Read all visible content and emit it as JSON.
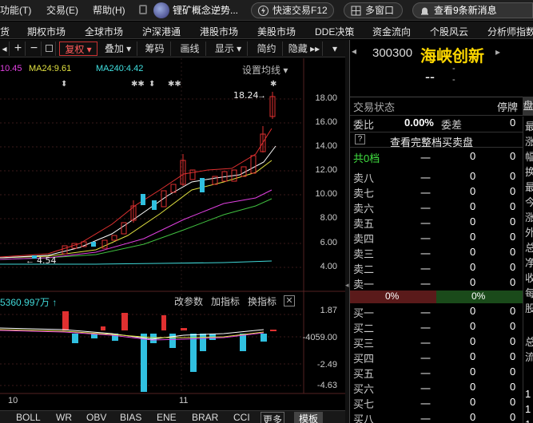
{
  "menubar": {
    "items": [
      "功能(T)",
      "交易(E)",
      "帮助(H)"
    ],
    "news_ticker": "锂矿概念逆势...",
    "quick_trade": "快速交易F12",
    "multi_window": "多窗口",
    "news_button": "查看9条新消息"
  },
  "navbar": {
    "items": [
      "货",
      "期权市场",
      "全球市场",
      "沪深港通",
      "港股市场",
      "美股市场",
      "DDE决策",
      "资金流向",
      "个股风云",
      "分析师指数"
    ]
  },
  "toolbar": {
    "fuquan": "复权",
    "diejia": "叠加",
    "chouma": "筹码",
    "huaxian": "画线",
    "xianshi": "显示",
    "jianyue": "简约",
    "yincang": "隐藏"
  },
  "chart": {
    "ma_legend": {
      "ma_prev": "10.45",
      "ma24": "MA24:9.61",
      "ma240": "MA240:4.42"
    },
    "settings_link": "设置均线",
    "y_axis": [
      "18.00",
      "16.00",
      "14.00",
      "12.00",
      "10.00",
      "8.00",
      "6.00",
      "4.00"
    ],
    "high_label": "18.24",
    "low_label": "4.54",
    "indicator_value": "5360.997万",
    "indicator_buttons": [
      "改参数",
      "加指标",
      "换指标"
    ],
    "indicator_y_axis": [
      "1.87",
      "-4059.00",
      "-2.49",
      "-4.63"
    ],
    "x_axis": [
      "10",
      "11"
    ]
  },
  "bottom_tabs": [
    "BOLL",
    "WR",
    "OBV",
    "BIAS",
    "ENE",
    "BRAR",
    "CCI",
    "更多",
    "模板"
  ],
  "right_panel": {
    "code": "300300",
    "name": "海峡创新",
    "price": "--",
    "change_dash": "-",
    "trade_status_label": "交易状态",
    "trade_status_value": "停牌",
    "weibi_label": "委比",
    "weibi_value": "0.00%",
    "weicha_label": "委差",
    "weicha_value": "0",
    "full_book": "查看完整档买卖盘",
    "total_levels": "共0档",
    "sell": [
      "卖八",
      "卖七",
      "卖六",
      "卖五",
      "卖四",
      "卖三",
      "卖二",
      "卖一"
    ],
    "buy": [
      "买一",
      "买二",
      "买三",
      "买四",
      "买五",
      "买六",
      "买七",
      "买八"
    ],
    "ratio_sell": "0%",
    "ratio_buy": "0%",
    "side_tab": "盘",
    "side_chars": [
      "最",
      "涨",
      "幅",
      "换",
      "最",
      "今",
      "涨",
      "外",
      "总",
      "净",
      "收",
      "每",
      "股",
      "总",
      "流"
    ]
  }
}
